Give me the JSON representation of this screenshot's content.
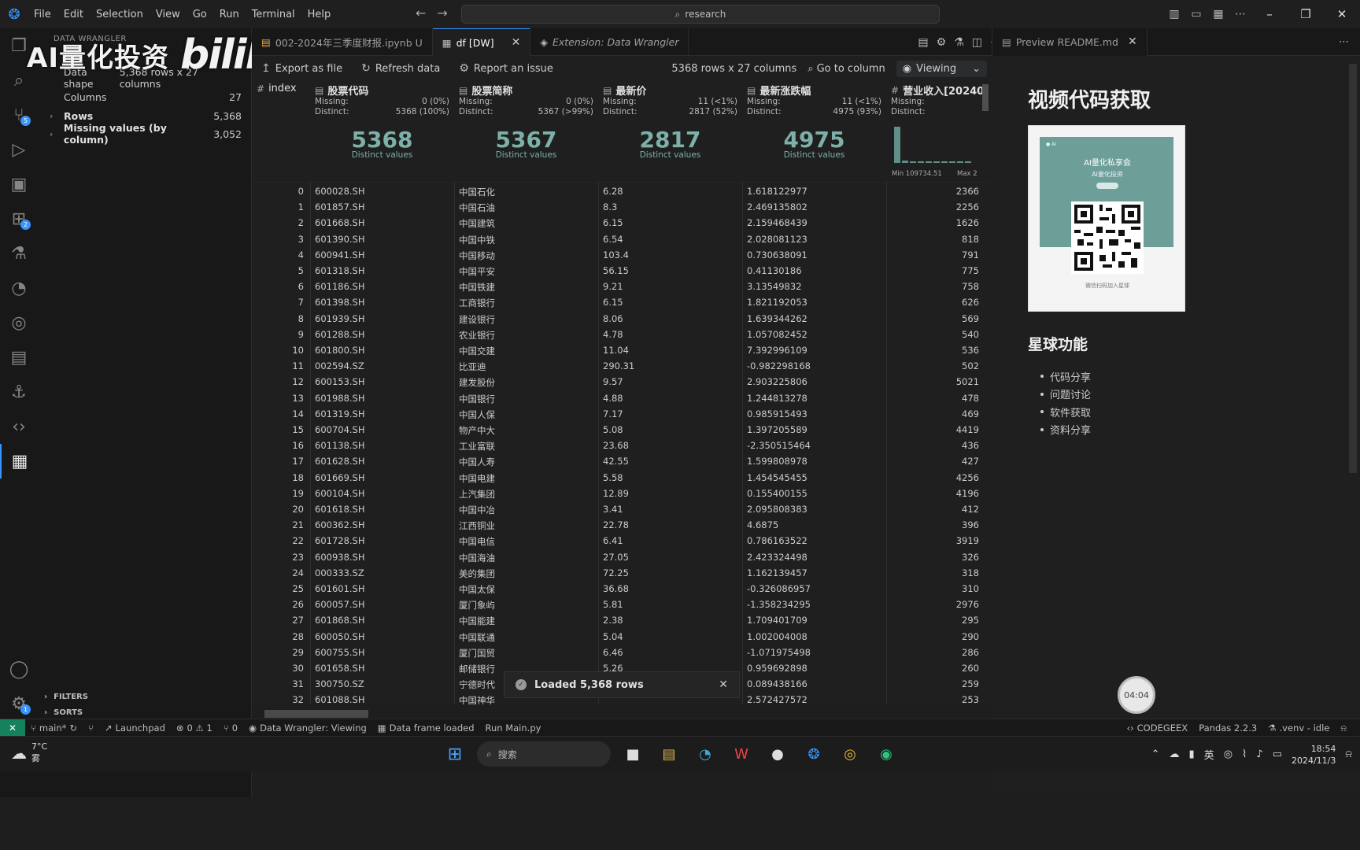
{
  "menu": [
    "File",
    "Edit",
    "Selection",
    "View",
    "Go",
    "Run",
    "Terminal",
    "Help"
  ],
  "search": {
    "label": "research"
  },
  "watermark": {
    "text": "AI量化投资",
    "logo": "bilibili"
  },
  "sidebar": {
    "title": "DATA WRANGLER",
    "rows": [
      {
        "label": "Data shape",
        "value": "5,368 rows x 27 columns",
        "bold": false,
        "chevron": false
      },
      {
        "label": "Columns",
        "value": "27",
        "bold": false,
        "chevron": false
      },
      {
        "label": "Rows",
        "value": "5,368",
        "bold": true,
        "chevron": true
      },
      {
        "label": "Missing values (by column)",
        "value": "3,052",
        "bold": true,
        "chevron": true
      }
    ],
    "filters": "FILTERS",
    "sorts": "SORTS"
  },
  "tabs": [
    {
      "label": "002-2024年三季度财报.ipynb U",
      "active": false,
      "italic": false,
      "close": false
    },
    {
      "label": "df [DW]",
      "active": true,
      "italic": false,
      "close": true
    },
    {
      "label": "Extension: Data Wrangler",
      "active": false,
      "italic": true,
      "close": false
    }
  ],
  "toolbar": {
    "export": "Export as file",
    "refresh": "Refresh data",
    "report": "Report an issue",
    "shape": "5368 rows x 27 columns",
    "goto": "Go to column",
    "viewing": "Viewing"
  },
  "grid": {
    "index_header": "index",
    "columns": [
      {
        "name": "股票代码",
        "missing_label": "Missing:",
        "missing": "0 (0%)",
        "distinct_label": "Distinct:",
        "distinct": "5368 (100%)",
        "big": "5368",
        "big_label": "Distinct values"
      },
      {
        "name": "股票简称",
        "missing_label": "Missing:",
        "missing": "0 (0%)",
        "distinct_label": "Distinct:",
        "distinct": "5367 (>99%)",
        "big": "5367",
        "big_label": "Distinct values"
      },
      {
        "name": "最新价",
        "missing_label": "Missing:",
        "missing": "11 (<1%)",
        "distinct_label": "Distinct:",
        "distinct": "2817 (52%)",
        "big": "2817",
        "big_label": "Distinct values"
      },
      {
        "name": "最新涨跌幅",
        "missing_label": "Missing:",
        "missing": "11 (<1%)",
        "distinct_label": "Distinct:",
        "distinct": "4975 (93%)",
        "big": "4975",
        "big_label": "Distinct values"
      },
      {
        "name": "营业收入[20240",
        "missing_label": "Missing:",
        "missing": "",
        "distinct_label": "Distinct:",
        "distinct": "",
        "big": "",
        "big_label": "",
        "min": "Min 109734.51",
        "max": "Max 2"
      }
    ],
    "rows": [
      [
        "0",
        "600028.SH",
        "中国石化",
        "6.28",
        "1.618122977",
        "2366"
      ],
      [
        "1",
        "601857.SH",
        "中国石油",
        "8.3",
        "2.469135802",
        "2256"
      ],
      [
        "2",
        "601668.SH",
        "中国建筑",
        "6.15",
        "2.159468439",
        "1626"
      ],
      [
        "3",
        "601390.SH",
        "中国中铁",
        "6.54",
        "2.028081123",
        "818"
      ],
      [
        "4",
        "600941.SH",
        "中国移动",
        "103.4",
        "0.730638091",
        "791"
      ],
      [
        "5",
        "601318.SH",
        "中国平安",
        "56.15",
        "0.41130186",
        "775"
      ],
      [
        "6",
        "601186.SH",
        "中国铁建",
        "9.21",
        "3.13549832",
        "758"
      ],
      [
        "7",
        "601398.SH",
        "工商银行",
        "6.15",
        "1.821192053",
        "626"
      ],
      [
        "8",
        "601939.SH",
        "建设银行",
        "8.06",
        "1.639344262",
        "569"
      ],
      [
        "9",
        "601288.SH",
        "农业银行",
        "4.78",
        "1.057082452",
        "540"
      ],
      [
        "10",
        "601800.SH",
        "中国交建",
        "11.04",
        "7.392996109",
        "536"
      ],
      [
        "11",
        "002594.SZ",
        "比亚迪",
        "290.31",
        "-0.982298168",
        "502"
      ],
      [
        "12",
        "600153.SH",
        "建发股份",
        "9.57",
        "2.903225806",
        "5021"
      ],
      [
        "13",
        "601988.SH",
        "中国银行",
        "4.88",
        "1.244813278",
        "478"
      ],
      [
        "14",
        "601319.SH",
        "中国人保",
        "7.17",
        "0.985915493",
        "469"
      ],
      [
        "15",
        "600704.SH",
        "物产中大",
        "5.08",
        "1.397205589",
        "4419"
      ],
      [
        "16",
        "601138.SH",
        "工业富联",
        "23.68",
        "-2.350515464",
        "436"
      ],
      [
        "17",
        "601628.SH",
        "中国人寿",
        "42.55",
        "1.599808978",
        "427"
      ],
      [
        "18",
        "601669.SH",
        "中国电建",
        "5.58",
        "1.454545455",
        "4256"
      ],
      [
        "19",
        "600104.SH",
        "上汽集团",
        "12.89",
        "0.155400155",
        "4196"
      ],
      [
        "20",
        "601618.SH",
        "中国中冶",
        "3.41",
        "2.095808383",
        "412"
      ],
      [
        "21",
        "600362.SH",
        "江西铜业",
        "22.78",
        "4.6875",
        "396"
      ],
      [
        "22",
        "601728.SH",
        "中国电信",
        "6.41",
        "0.786163522",
        "3919"
      ],
      [
        "23",
        "600938.SH",
        "中国海油",
        "27.05",
        "2.423324498",
        "326"
      ],
      [
        "24",
        "000333.SZ",
        "美的集团",
        "72.25",
        "1.162139457",
        "318"
      ],
      [
        "25",
        "601601.SH",
        "中国太保",
        "36.68",
        "-0.326086957",
        "310"
      ],
      [
        "26",
        "600057.SH",
        "厦门象屿",
        "5.81",
        "-1.358234295",
        "2976"
      ],
      [
        "27",
        "601868.SH",
        "中国能建",
        "2.38",
        "1.709401709",
        "295"
      ],
      [
        "28",
        "600050.SH",
        "中国联通",
        "5.04",
        "1.002004008",
        "290"
      ],
      [
        "29",
        "600755.SH",
        "厦门国贸",
        "6.46",
        "-1.071975498",
        "286"
      ],
      [
        "30",
        "601658.SH",
        "邮储银行",
        "5.26",
        "0.959692898",
        "260"
      ],
      [
        "31",
        "300750.SZ",
        "宁德时代",
        "",
        "0.089438166",
        "259"
      ],
      [
        "32",
        "601088.SH",
        "中国神华",
        "",
        "2.572427572",
        "253"
      ]
    ]
  },
  "toast": {
    "text": "Loaded 5,368 rows"
  },
  "preview": {
    "tab": "Preview README.md",
    "h1": "视频代码获取",
    "img_title": "AI量化私享会",
    "img_sub": "AI量化投资",
    "img_caption": "微信扫码加入星球",
    "h2": "星球功能",
    "items": [
      "代码分享",
      "问题讨论",
      "软件获取",
      "资料分享"
    ],
    "timer": "04:04"
  },
  "status": {
    "branch": "main*",
    "launchpad": "Launchpad",
    "problems": "0 ⚠ 1",
    "ports": "0",
    "dw": "Data Wrangler: Viewing",
    "df": "Data frame loaded",
    "run": "Run Main.py",
    "codegeex": "CODEGEEX",
    "pandas": "Pandas 2.2.3",
    "venv": ".venv - idle"
  },
  "taskbar": {
    "temp": "7°C",
    "weather": "雾",
    "search": "搜索",
    "ime": "英",
    "time": "18:54",
    "date": "2024/11/3"
  }
}
